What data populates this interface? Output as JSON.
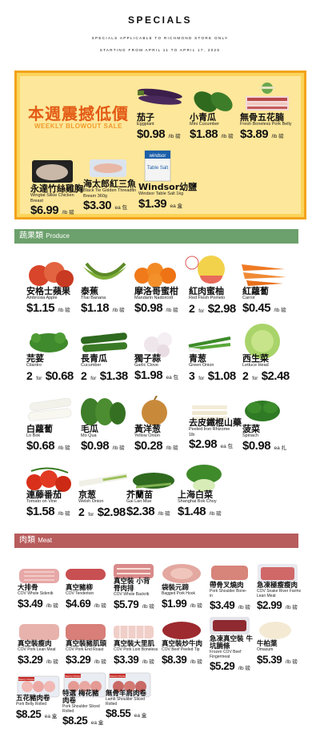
{
  "header": {
    "title": "SPECIALS",
    "subtitle": "SPECIALS APPLICABLE TO RICHMOND STORE ONLY",
    "dates": "STARTING FROM APRIL 11 TO APRIL 17, 2025"
  },
  "blowout": {
    "title_zh": "本週震撼低價",
    "title_en": "WEEKLY BLOWOUT SALE",
    "items": [
      {
        "zh": "茄子",
        "en": "Eggplant",
        "price": "$0.98",
        "unit": "/lb 磅"
      },
      {
        "zh": "小青瓜",
        "en": "Mini Cucumber",
        "price": "$1.88",
        "unit": "/lb 磅"
      },
      {
        "zh": "無骨五花腩",
        "en": "Fresh Boneless Pork Belly",
        "price": "$3.89",
        "unit": "/lb 磅"
      },
      {
        "zh": "永達竹絲雞胸",
        "en": "Wingtat Silkie Chicken Breast",
        "price": "$6.99",
        "unit": "/lb 磅"
      },
      {
        "zh": "海太郎紅三魚",
        "en": "Black Tie Golden Threadfin Bream 360g",
        "price": "$3.30",
        "unit": "ea 包"
      },
      {
        "zh": "Windsor幼鹽",
        "en": "Windsor Table Salt 1kg",
        "price": "$1.39",
        "unit": "ea 盒"
      }
    ]
  },
  "produce": {
    "title_zh": "蔬果類",
    "title_en": "Produce",
    "items": [
      {
        "zh": "安格士蘋果",
        "en": "Ambrosia Apple",
        "qty": "",
        "price": "$1.15",
        "unit": "/lb 磅"
      },
      {
        "zh": "泰蕉",
        "en": "Thai Banana",
        "qty": "",
        "price": "$1.18",
        "unit": "/lb 磅"
      },
      {
        "zh": "摩洛哥蜜柑",
        "en": "Mandarin Nadorcott",
        "qty": "",
        "price": "$0.98",
        "unit": "/lb 磅"
      },
      {
        "zh": "紅肉蜜柚",
        "en": "Red Flesh Pomelo",
        "qty": "2",
        "price": "$2.98",
        "unit": ""
      },
      {
        "zh": "紅蘿蔔",
        "en": "Carrot",
        "qty": "",
        "price": "$0.45",
        "unit": "/lb 磅"
      },
      {
        "zh": "芫荽",
        "en": "Cilantro",
        "qty": "2",
        "price": "$0.68",
        "unit": ""
      },
      {
        "zh": "長青瓜",
        "en": "Cucumber",
        "qty": "2",
        "price": "$1.38",
        "unit": ""
      },
      {
        "zh": "獨子蒜",
        "en": "Garlic Clove",
        "qty": "",
        "price": "$1.98",
        "unit": "ea 包"
      },
      {
        "zh": "青葱",
        "en": "Green Onion",
        "qty": "3",
        "price": "$1.08",
        "unit": ""
      },
      {
        "zh": "西生菜",
        "en": "Lettuce Head",
        "qty": "2",
        "price": "$2.48",
        "unit": ""
      },
      {
        "zh": "白蘿蔔",
        "en": "Lo Bok",
        "qty": "",
        "price": "$0.68",
        "unit": "/lb 磅"
      },
      {
        "zh": "毛瓜",
        "en": "Mo Qua",
        "qty": "",
        "price": "$0.98",
        "unit": "/lb 磅"
      },
      {
        "zh": "黃洋葱",
        "en": "Yellow Onion",
        "qty": "",
        "price": "$0.28",
        "unit": "/lb 磅"
      },
      {
        "zh": "去皮鐵棍山藥",
        "en": "Peeled Iron Rhizome 1lb",
        "qty": "",
        "price": "$2.98",
        "unit": "ea 包"
      },
      {
        "zh": "菠菜",
        "en": "Spinach",
        "qty": "",
        "price": "$0.98",
        "unit": "ea 扎"
      },
      {
        "zh": "連藤番茄",
        "en": "Tomato on Vine",
        "qty": "",
        "price": "$1.58",
        "unit": "/lb 磅"
      },
      {
        "zh": "京葱",
        "en": "Welsh Onion",
        "qty": "2",
        "price": "$2.98",
        "unit": ""
      },
      {
        "zh": "芥蘭苗",
        "en": "Gai Lan Mue",
        "qty": "",
        "price": "$2.38",
        "unit": "/lb 磅"
      },
      {
        "zh": "上海白菜",
        "en": "Shanghai Bok Choy",
        "qty": "",
        "price": "$1.48",
        "unit": "/lb 磅"
      }
    ]
  },
  "meat": {
    "title_zh": "肉類",
    "title_en": "Meat",
    "items": [
      {
        "zh": "大排骨",
        "en": "COV Whole Sidenib",
        "price": "$3.49",
        "unit": "/lb 磅"
      },
      {
        "zh": "真空豬柳",
        "en": "COV Tenderloin",
        "price": "$4.69",
        "unit": "/lb 磅"
      },
      {
        "zh": "真空裝 小背脊肉排",
        "en": "COV Whole Backrib",
        "price": "$5.79",
        "unit": "/lb 磅"
      },
      {
        "zh": "袋裝元蹄",
        "en": "Bagged Pork Hook",
        "price": "$1.99",
        "unit": "/lb 磅"
      },
      {
        "zh": "帶骨叉燒肉",
        "en": "Pork Shoulder Bone-in",
        "price": "$3.49",
        "unit": "/lb 磅"
      },
      {
        "zh": "急凍極瘦瘦肉",
        "en": "COV Snake River Farms Lean Meat",
        "price": "$2.99",
        "unit": "/lb 磅"
      },
      {
        "zh": "真空裝瘦肉",
        "en": "COV Pork Lean Meat",
        "price": "$3.29",
        "unit": "/lb 磅"
      },
      {
        "zh": "真空裝豬肌頭",
        "en": "COV Pork End Roast",
        "price": "$3.29",
        "unit": "/lb 磅"
      },
      {
        "zh": "真空裝大里肌",
        "en": "COV Pork Loin Boneless",
        "price": "$3.39",
        "unit": "/lb 磅"
      },
      {
        "zh": "真空裝炒牛肉",
        "en": "COV Beef Peeled Tip",
        "price": "$8.39",
        "unit": "/lb 磅"
      },
      {
        "zh": "急凍真空裝 牛坑腩條",
        "en": "Frozen COV Beef Fingermeat",
        "price": "$5.29",
        "unit": "/lb 磅"
      },
      {
        "zh": "牛柏葉",
        "en": "Omasum",
        "price": "$5.39",
        "unit": "/lb 磅"
      },
      {
        "zh": "五花豬肉卷",
        "en": "Pork Belly Rolled",
        "price": "$8.25",
        "unit": "ea 盒"
      },
      {
        "zh": "特選 梅花豬肉卷",
        "en": "Pork Shoulder Sliced Rolled",
        "price": "$8.25",
        "unit": "ea 盒"
      },
      {
        "zh": "無骨羊肩肉卷",
        "en": "Lamb Shoulder Sliced Rolled",
        "price": "$8.55",
        "unit": "ea 盒"
      }
    ]
  },
  "badges": {
    "savory": "Savory Choice",
    "table_salt": "Table Salt",
    "windsor": "windsor"
  },
  "colors": {
    "produce": "#6ca06c",
    "meat": "#b85c5c",
    "blowout_title": "#e35b15",
    "blowout_border": "#f2a31b"
  }
}
